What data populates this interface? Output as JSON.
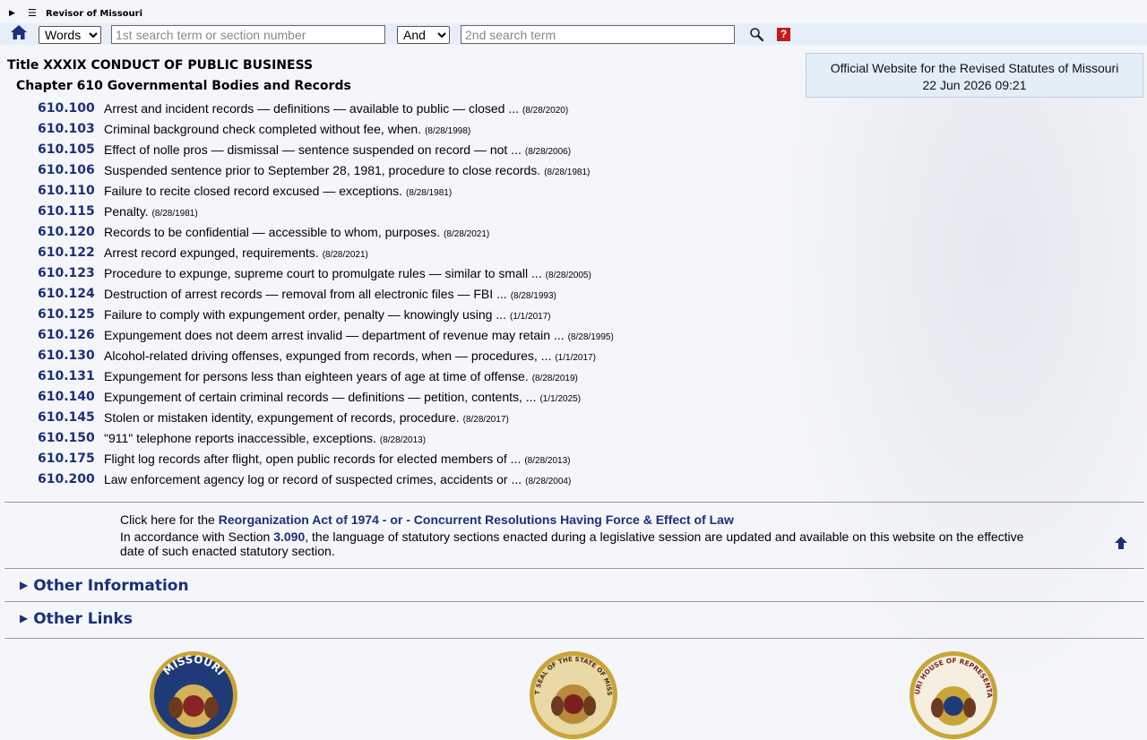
{
  "header": {
    "brand": "Revisor of Missouri",
    "search_type_options": [
      "Words"
    ],
    "search_type_selected": "Words",
    "search_term1_placeholder": "1st search term or section number",
    "search_term1_value": "",
    "connector_selected": "And",
    "search_term2_placeholder": "2nd search term",
    "search_term2_value": "",
    "help_label": "?"
  },
  "official": {
    "line1": "Official Website for the Revised Statutes of Missouri",
    "line2": "22 Jun 2026 09:21"
  },
  "title": "Title XXXIX CONDUCT OF PUBLIC BUSINESS",
  "chapter": "Chapter 610 Governmental Bodies and Records",
  "sections": [
    {
      "num": "610.100",
      "desc": "Arrest and incident records — definitions — available to public — closed ...",
      "date": "(8/28/2020)"
    },
    {
      "num": "610.103",
      "desc": "Criminal background check completed without fee, when.",
      "date": "(8/28/1998)"
    },
    {
      "num": "610.105",
      "desc": "Effect of nolle pros — dismissal — sentence suspended on record — not ...",
      "date": "(8/28/2006)"
    },
    {
      "num": "610.106",
      "desc": "Suspended sentence prior to September 28, 1981, procedure to close records.",
      "date": "(8/28/1981)"
    },
    {
      "num": "610.110",
      "desc": "Failure to recite closed record excused — exceptions.",
      "date": "(8/28/1981)"
    },
    {
      "num": "610.115",
      "desc": "Penalty.",
      "date": "(8/28/1981)"
    },
    {
      "num": "610.120",
      "desc": "Records to be confidential — accessible to whom, purposes.",
      "date": "(8/28/2021)"
    },
    {
      "num": "610.122",
      "desc": "Arrest record expunged, requirements.",
      "date": "(8/28/2021)"
    },
    {
      "num": "610.123",
      "desc": "Procedure to expunge, supreme court to promulgate rules — similar to small ...",
      "date": "(8/28/2005)"
    },
    {
      "num": "610.124",
      "desc": "Destruction of arrest records — removal from all electronic files — FBI ...",
      "date": "(8/28/1993)"
    },
    {
      "num": "610.125",
      "desc": "Failure to comply with expungement order, penalty — knowingly using ...",
      "date": "(1/1/2017)"
    },
    {
      "num": "610.126",
      "desc": "Expungement does not deem arrest invalid — department of revenue may retain ...",
      "date": "(8/28/1995)"
    },
    {
      "num": "610.130",
      "desc": "Alcohol-related driving offenses, expunged from records, when — procedures, ...",
      "date": "(1/1/2017)"
    },
    {
      "num": "610.131",
      "desc": "Expungement for persons less than eighteen years of age at time of offense.",
      "date": "(8/28/2019)"
    },
    {
      "num": "610.140",
      "desc": "Expungement of certain criminal records — definitions — petition, contents, ...",
      "date": "(1/1/2025)"
    },
    {
      "num": "610.145",
      "desc": "Stolen or mistaken identity, expungement of records, procedure.",
      "date": "(8/28/2017)"
    },
    {
      "num": "610.150",
      "desc": "\"911\" telephone reports inaccessible, exceptions.",
      "date": "(8/28/2013)"
    },
    {
      "num": "610.175",
      "desc": "Flight log records after flight, open public records for elected members of ...",
      "date": "(8/28/2013)"
    },
    {
      "num": "610.200",
      "desc": "Law enforcement agency log or record of suspected crimes, accidents or ...",
      "date": "(8/28/2004)"
    }
  ],
  "reorg": {
    "prefix": "Click here for the ",
    "link1": "Reorganization Act of 1974",
    "sep": " - or - ",
    "link2": "Concurrent Resolutions Having Force & Effect of Law",
    "note_prefix": "In accordance with Section ",
    "note_link": "3.090",
    "note_suffix": ", the language of statutory sections enacted during a legislative session are updated and available on this website on the effective date of such enacted statutory section."
  },
  "other_information": "Other Information",
  "other_links": "Other Links",
  "seal_texts": {
    "seal1": "MISSOURI",
    "seal2": "GREAT SEAL OF THE STATE OF MISSOURI",
    "seal3": "MISSOURI HOUSE OF REPRESENTATIVES"
  },
  "colors": {
    "link": "#1c2f7a",
    "help": "#c41a1a",
    "bar": "#e6eefa"
  }
}
